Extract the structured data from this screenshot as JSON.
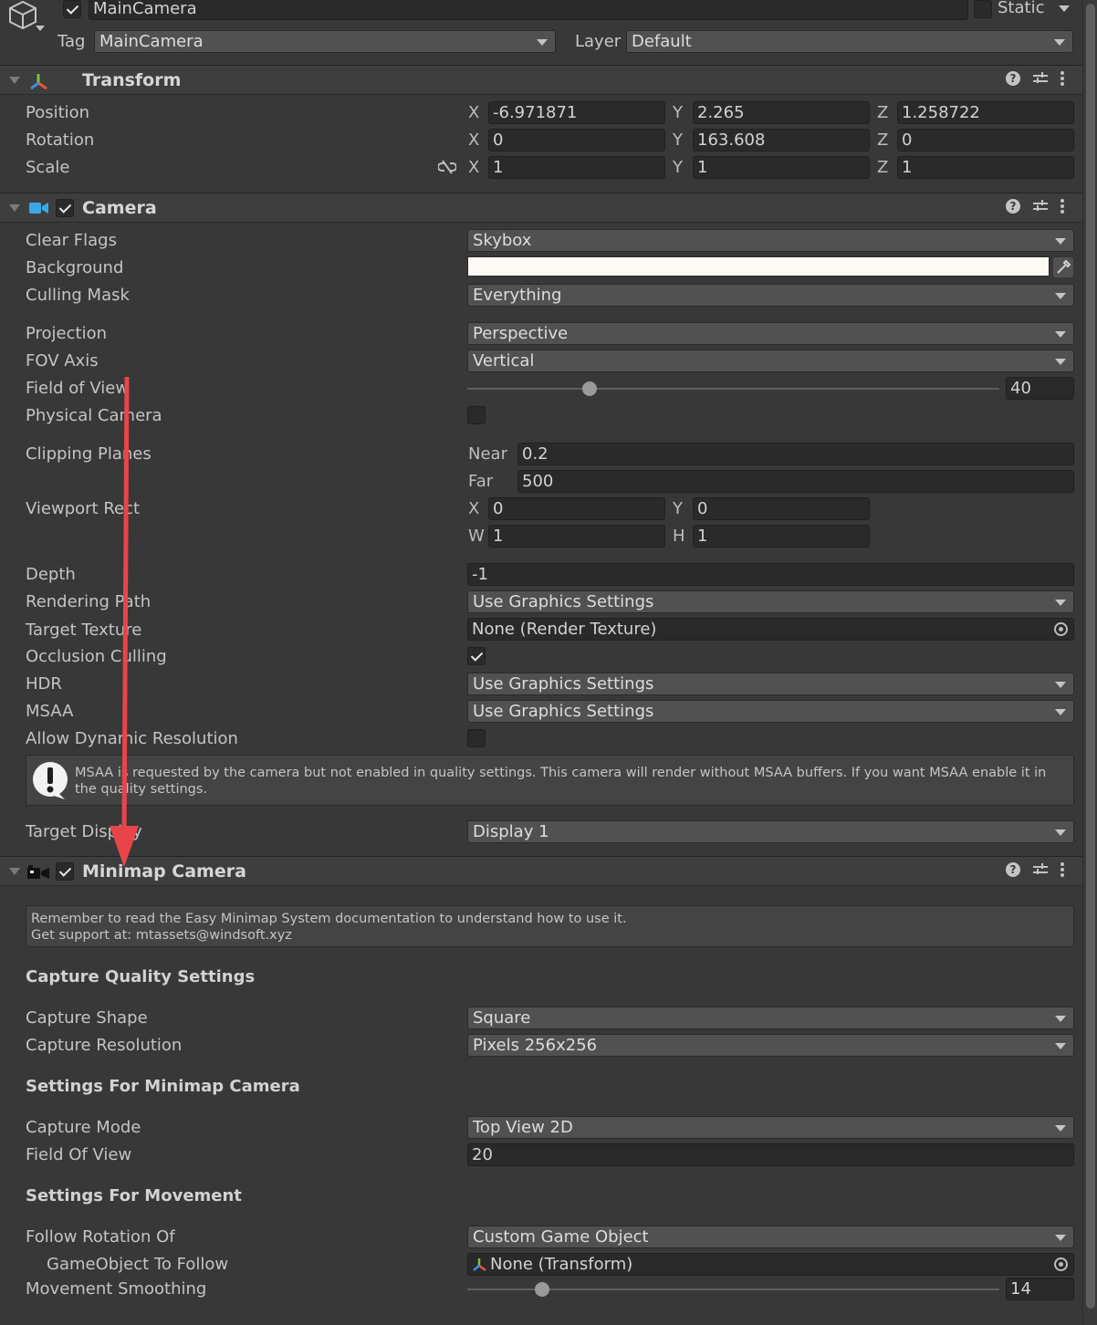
{
  "object": {
    "name": "MainCamera",
    "static_label": "Static",
    "tag_label": "Tag",
    "tag_value": "MainCamera",
    "layer_label": "Layer",
    "layer_value": "Default"
  },
  "transform": {
    "title": "Transform",
    "position_label": "Position",
    "rotation_label": "Rotation",
    "scale_label": "Scale",
    "axes": {
      "x": "X",
      "y": "Y",
      "z": "Z"
    },
    "position": {
      "x": "-6.971871",
      "y": "2.265",
      "z": "1.258722"
    },
    "rotation": {
      "x": "0",
      "y": "163.608",
      "z": "0"
    },
    "scale": {
      "x": "1",
      "y": "1",
      "z": "1"
    }
  },
  "camera": {
    "title": "Camera",
    "clear_flags": {
      "label": "Clear Flags",
      "value": "Skybox"
    },
    "background": {
      "label": "Background",
      "color": "#fdf9f4"
    },
    "culling_mask": {
      "label": "Culling Mask",
      "value": "Everything"
    },
    "projection": {
      "label": "Projection",
      "value": "Perspective"
    },
    "fov_axis": {
      "label": "FOV Axis",
      "value": "Vertical"
    },
    "field_of_view": {
      "label": "Field of View",
      "value": "40",
      "slider_fraction": 0.23
    },
    "physical_camera": {
      "label": "Physical Camera",
      "checked": false
    },
    "clipping_planes": {
      "label": "Clipping Planes",
      "near_label": "Near",
      "near": "0.2",
      "far_label": "Far",
      "far": "500"
    },
    "viewport_rect": {
      "label": "Viewport Rect",
      "x_label": "X",
      "x": "0",
      "y_label": "Y",
      "y": "0",
      "w_label": "W",
      "w": "1",
      "h_label": "H",
      "h": "1"
    },
    "depth": {
      "label": "Depth",
      "value": "-1"
    },
    "rendering_path": {
      "label": "Rendering Path",
      "value": "Use Graphics Settings"
    },
    "target_texture": {
      "label": "Target Texture",
      "value": "None (Render Texture)"
    },
    "occlusion_culling": {
      "label": "Occlusion Culling",
      "checked": true
    },
    "hdr": {
      "label": "HDR",
      "value": "Use Graphics Settings"
    },
    "msaa": {
      "label": "MSAA",
      "value": "Use Graphics Settings"
    },
    "allow_dynamic_resolution": {
      "label": "Allow Dynamic Resolution",
      "checked": false
    },
    "warning": "MSAA is requested by the camera but not enabled in quality settings. This camera will render without MSAA buffers. If you want MSAA enable it in the quality settings.",
    "target_display": {
      "label": "Target Display",
      "value": "Display 1"
    }
  },
  "minimap": {
    "title": "Minimap Camera",
    "info_line1": "Remember to read the Easy Minimap System documentation to understand how to use it.",
    "info_line2": "Get support at: mtassets@windsoft.xyz",
    "capture_quality_title": "Capture Quality Settings",
    "capture_shape": {
      "label": "Capture Shape",
      "value": "Square"
    },
    "capture_resolution": {
      "label": "Capture Resolution",
      "value": "Pixels 256x256"
    },
    "settings_camera_title": "Settings For Minimap Camera",
    "capture_mode": {
      "label": "Capture Mode",
      "value": "Top View 2D"
    },
    "field_of_view": {
      "label": "Field Of View",
      "value": "20"
    },
    "settings_movement_title": "Settings For Movement",
    "follow_rotation_of": {
      "label": "Follow Rotation Of",
      "value": "Custom Game Object"
    },
    "gameobject_to_follow": {
      "label": "GameObject To Follow",
      "value": "None (Transform)"
    },
    "movement_smoothing": {
      "label": "Movement Smoothing",
      "value": "14",
      "slider_fraction": 0.14
    }
  },
  "annotation": {
    "arrow_color": "#e8454a"
  },
  "colors": {
    "background": "#383838",
    "field": "#2a2a2a",
    "dropdown": "#515151"
  }
}
